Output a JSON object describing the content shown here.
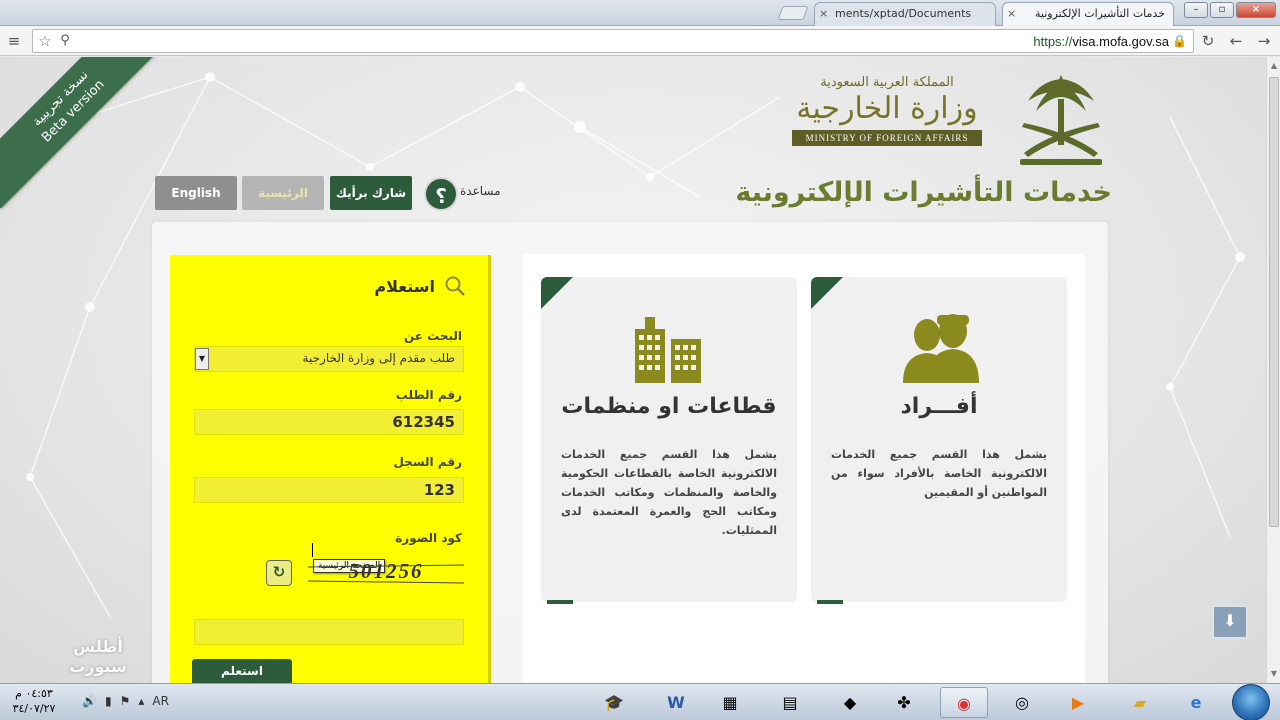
{
  "browser": {
    "tabs": [
      {
        "title": "خدمات التأشيرات الإلكترونية",
        "active": true
      },
      {
        "title": "ments/xptad/Documents",
        "active": false
      }
    ],
    "url_scheme": "https://",
    "url_host": "visa.mofa.gov.sa"
  },
  "beta_badge": {
    "arabic": "نسخة تجريبية",
    "english": "Beta version"
  },
  "header": {
    "kingdom": "المملكة العربية السعودية",
    "ministry_ar": "وزارة الخارجية",
    "ministry_en": "MINISTRY OF FOREIGN AFFAIRS",
    "service_title": "خدمات التأشيرات الإلكترونية"
  },
  "nav": {
    "english": "English",
    "home": "الرئيسية",
    "share": "شارك برأيك",
    "help_label": "مساعدة",
    "help_symbol": "؟"
  },
  "inquiry_form": {
    "title": "استعلام",
    "search_for_label": "البحث عن",
    "search_for_value": "طلب مقدم إلى وزارة الخارجية",
    "request_no_label": "رقم الطلب",
    "request_no_value": "612345",
    "record_no_label": "رقم السجل",
    "record_no_value": "123",
    "tooltip": "الصفحة الرئيسية",
    "captcha_label": "كود الصورة",
    "captcha_value": "501256",
    "captcha_input_value": "",
    "submit_label": "استعلم"
  },
  "cards": [
    {
      "title": "أفـــراد",
      "description": "يشمل هذا القسم جميع الخدمات الالكترونية الخاصة بالأفراد سواء من المواطنين أو المقيمين",
      "icon": "people-icon"
    },
    {
      "title": "قطاعات او منظمات",
      "description": "يشمل هذا القسم جميع الخدمات الالكترونية الخاصة بالقطاعات الحكومية والخاصة والمنظمات ومكاتب الخدمات ومكاتب الحج والعمرة المعتمدة لدى الممثليات.",
      "icon": "buildings-icon"
    }
  ],
  "watermark": {
    "text": "أطلس سبورت"
  },
  "taskbar": {
    "time": "٠٤:٥٣ م",
    "date": "٣٤/٠٧/٢٧",
    "language": "AR"
  },
  "colors": {
    "brand_green": "#2d5c3d",
    "olive": "#6c7c2e",
    "highlight_yellow": "#ffff00"
  }
}
